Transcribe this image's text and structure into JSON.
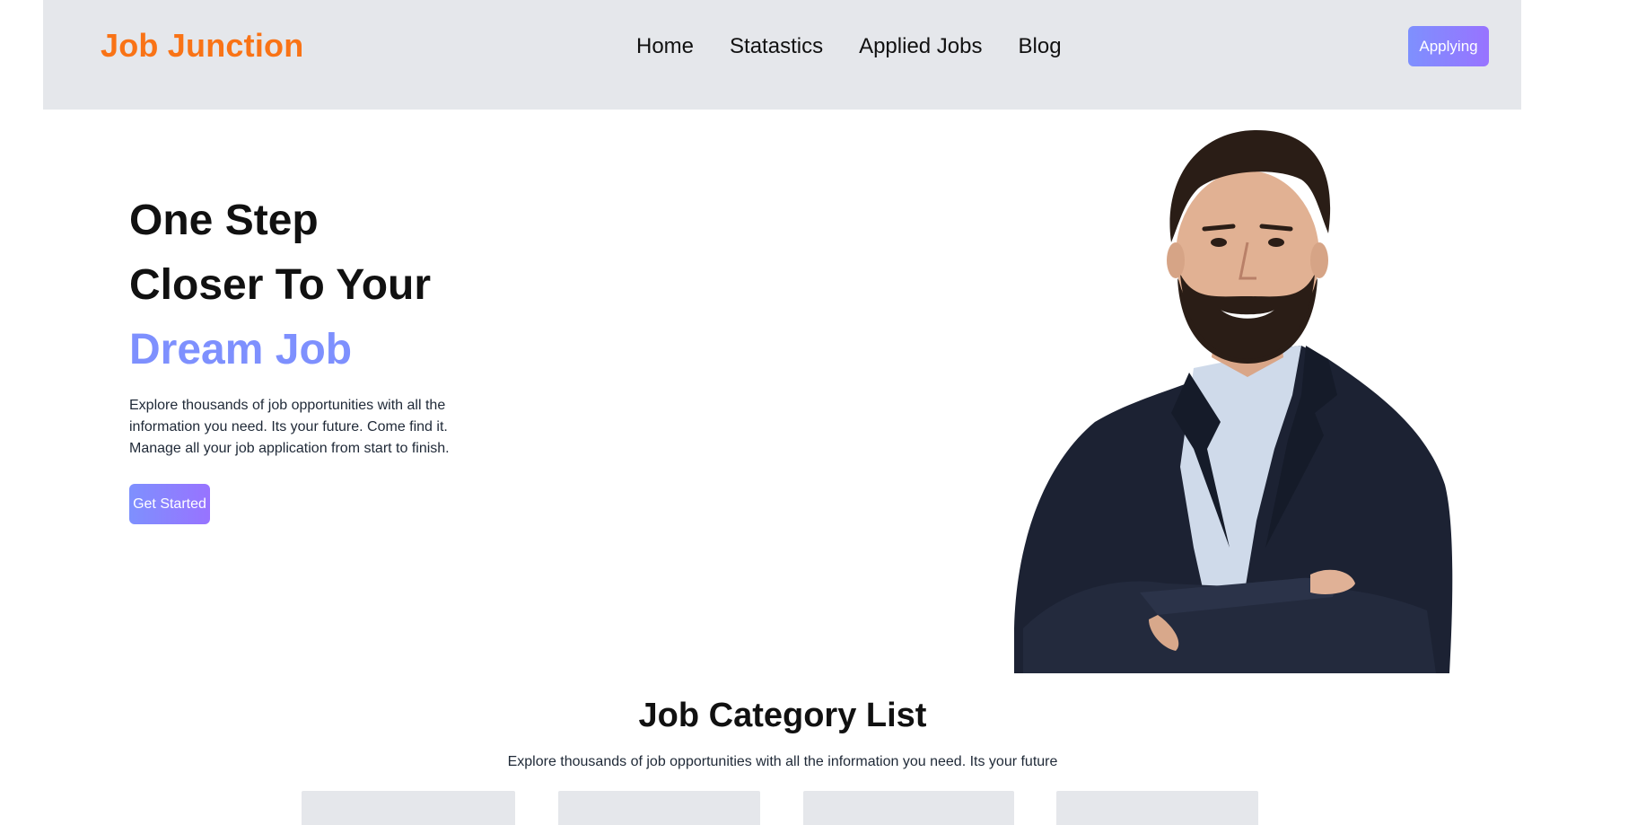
{
  "header": {
    "logo": "Job Junction",
    "nav": [
      {
        "label": "Home"
      },
      {
        "label": "Statastics"
      },
      {
        "label": "Applied Jobs"
      },
      {
        "label": "Blog"
      }
    ],
    "cta_label": "Applying"
  },
  "hero": {
    "title_line1": "One Step",
    "title_line2": "Closer To Your",
    "title_line3": "Dream Job",
    "description_lines": [
      "Explore thousands of job opportunities with all the",
      "information you need. Its your future. Come find it.",
      "Manage all your job application from start to finish."
    ],
    "button_label": "Get Started"
  },
  "categories": {
    "title": "Job Category List",
    "description": "Explore thousands of job opportunities with all the information you need. Its your future"
  },
  "colors": {
    "accent": "#7e90fe",
    "accent_end": "#9873ff",
    "logo": "#f97316",
    "header_bg": "#e5e7eb"
  }
}
